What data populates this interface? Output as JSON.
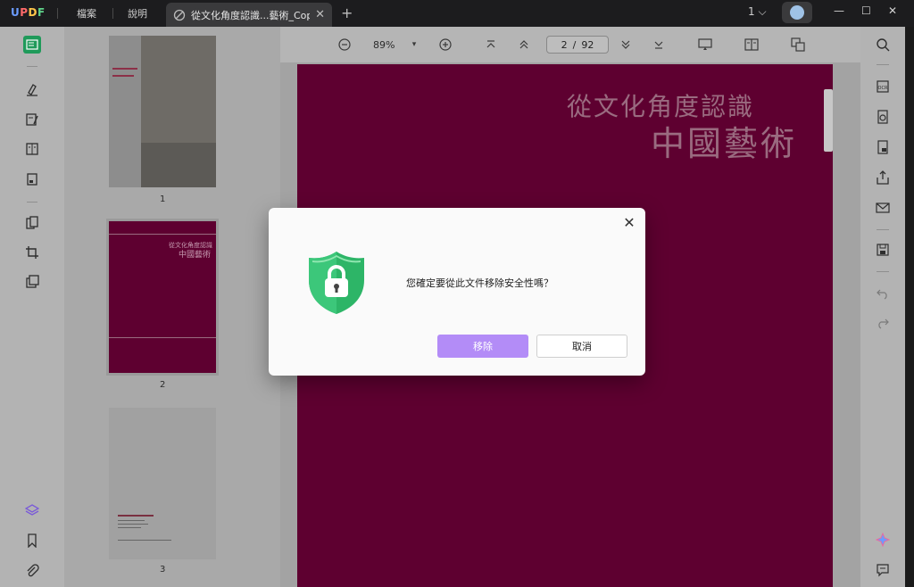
{
  "app": {
    "logo_u": "U",
    "logo_p": "P",
    "logo_d": "D",
    "logo_f": "F",
    "menu": {
      "file": "檔案",
      "help": "說明"
    },
    "tab": {
      "label": "從文化角度認識...藝術_Copy",
      "close": "✕"
    },
    "new_tab": "+",
    "page_indicator": "1",
    "window": {
      "minimize": "—",
      "maximize": "☐",
      "close": "✕"
    }
  },
  "toolbar": {
    "zoom": "89%",
    "current_page": "2",
    "separator": "/",
    "total_pages": "92"
  },
  "thumbnails": {
    "items": [
      {
        "number": "1"
      },
      {
        "number": "2"
      },
      {
        "number": "3"
      }
    ]
  },
  "page": {
    "title_line1": "從文化角度認識",
    "title_line2": "中國藝術"
  },
  "dialog": {
    "message": "您確定要從此文件移除安全性嗎？",
    "remove_label": "移除",
    "cancel_label": "取消",
    "close": "✕"
  },
  "colors": {
    "accent": "#b38cf7",
    "page_bg": "#5e0030",
    "shield_green": "#2db567",
    "overlay": "rgba(0,0,0,0.3)"
  }
}
